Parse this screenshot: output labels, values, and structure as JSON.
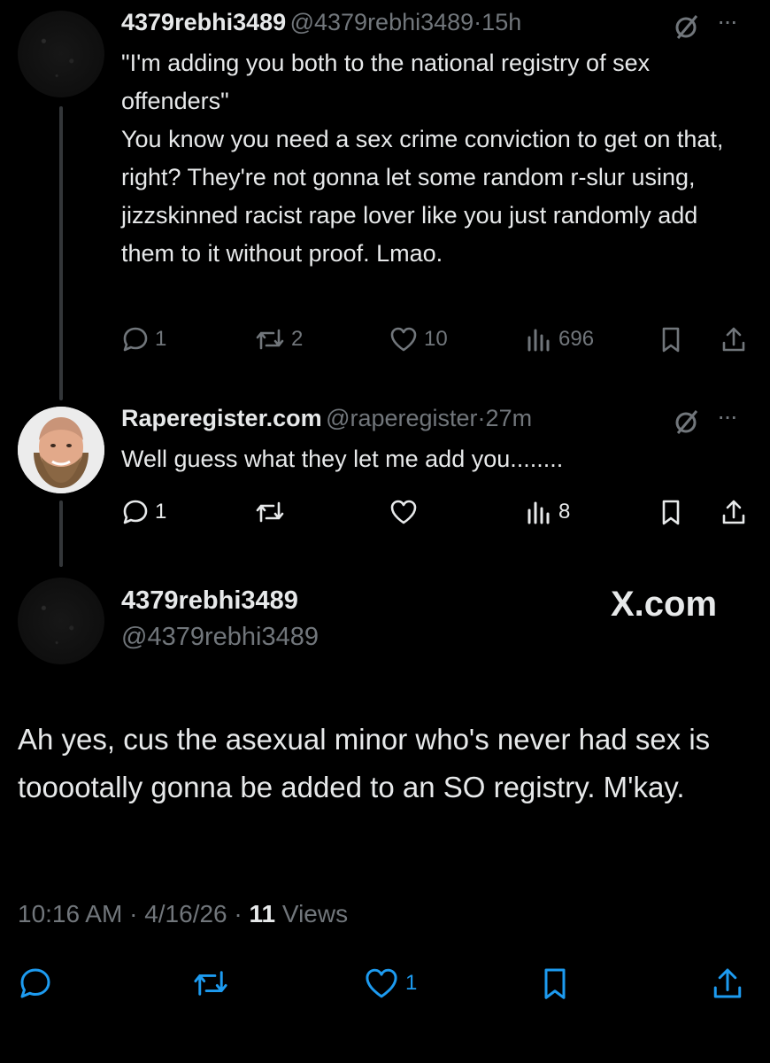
{
  "tweet1": {
    "name": "4379rebhi3489",
    "handle": "@4379rebhi3489",
    "sep": "·",
    "time": "15h",
    "text": "\"I'm adding you both to the national registry of sex offenders\"\nYou know you need a sex crime conviction to get on that, right? They're not gonna let some random r-slur using, jizzskinned racist rape lover like you just randomly add them to it without proof. Lmao.",
    "replies": "1",
    "reposts": "2",
    "likes": "10",
    "views": "696"
  },
  "tweet2": {
    "name": "Raperegister.com",
    "handle": "@raperegister",
    "sep": "·",
    "time": "27m",
    "text": "Well guess what they let me add you........",
    "replies": "1",
    "views": "8"
  },
  "main": {
    "name": "4379rebhi3489",
    "handle": "@4379rebhi3489",
    "brand": "X.com",
    "text": "Ah yes, cus the asexual minor who's never had sex is tooootally gonna be added to an SO registry. M'kay.",
    "time": "10:16 AM",
    "sep1": "·",
    "date": "4/16/26",
    "sep2": "·",
    "views_count": "11",
    "views_label": "Views",
    "likes": "1"
  },
  "icons": {
    "reply": "reply-icon",
    "repost": "repost-icon",
    "like": "like-icon",
    "views": "views-icon",
    "bookmark": "bookmark-icon",
    "share": "share-icon",
    "grok": "grok-icon",
    "more": "more-icon"
  },
  "colors": {
    "background": "#000000",
    "text": "#e7e9ea",
    "muted": "#71767b",
    "line": "#333639"
  }
}
